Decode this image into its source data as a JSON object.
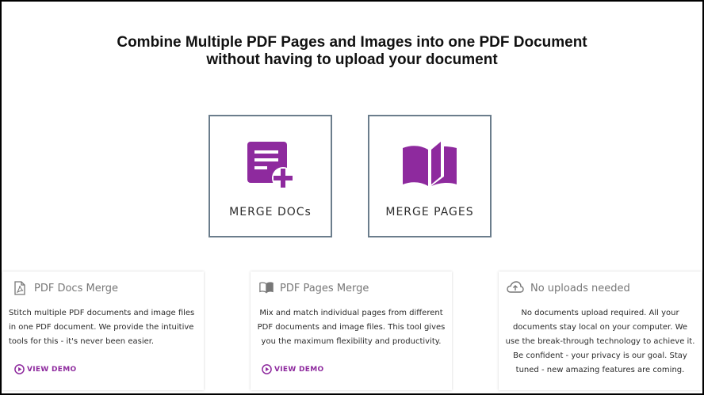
{
  "header": {
    "line1": "Combine Multiple PDF Pages and Images into one PDF Document",
    "line2": "without having to upload your document"
  },
  "tools": [
    {
      "label": "MERGE DOCs",
      "icon": "document-add-icon"
    },
    {
      "label": "MERGE PAGES",
      "icon": "open-book-icon"
    }
  ],
  "features": [
    {
      "title": "PDF Docs Merge",
      "icon": "pdf-file-icon",
      "description": "Stitch multiple PDF documents and image files in one PDF document. We provide the intuitive tools for this - it's never been easier.",
      "demo_label": "VIEW DEMO"
    },
    {
      "title": "PDF Pages Merge",
      "icon": "book-icon",
      "description": "Mix and match individual pages from different PDF documents and image files. This tool gives you the maximum flexibility and productivity.",
      "demo_label": "VIEW DEMO"
    },
    {
      "title": "No uploads needed",
      "icon": "cloud-upload-icon",
      "description": "No documents upload required. All your documents stay local on your computer. We use the break-through technology to achieve it. Be confident - your privacy is our goal. Stay tuned - new amazing features are coming."
    }
  ],
  "colors": {
    "accent": "#8e2a9e",
    "card_border": "#6b7d8c"
  }
}
